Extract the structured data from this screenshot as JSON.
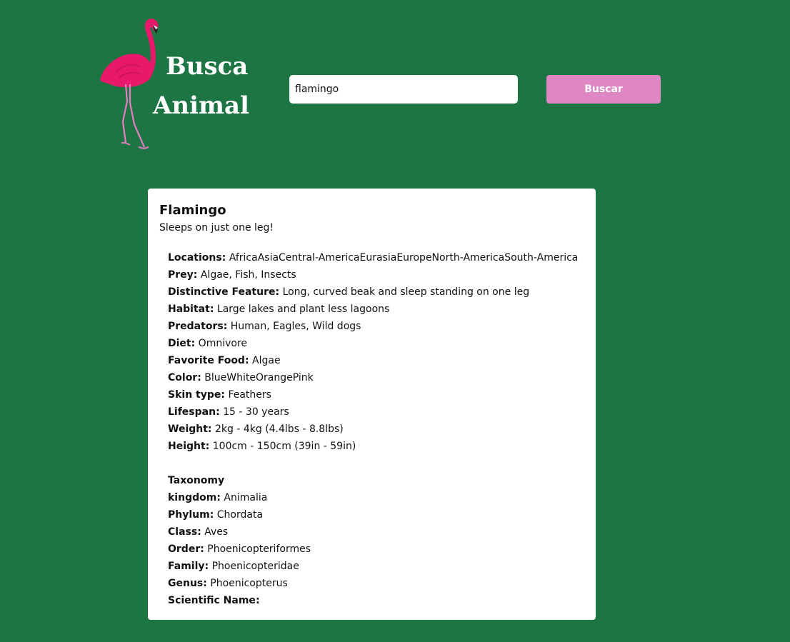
{
  "header": {
    "logo_line1": "Busca",
    "logo_line2": "Animal",
    "search_value": "flamingo",
    "search_button": "Buscar"
  },
  "colors": {
    "background": "#1c7543",
    "button": "#de87c3",
    "flamingo": "#e8196a"
  },
  "animal": {
    "name": "Flamingo",
    "slogan": "Sleeps on just one leg!",
    "characteristics": [
      {
        "label": "Locations",
        "value": "AfricaAsiaCentral-AmericaEurasiaEuropeNorth-AmericaSouth-America"
      },
      {
        "label": "Prey",
        "value": "Algae, Fish, Insects"
      },
      {
        "label": "Distinctive Feature",
        "value": "Long, curved beak and sleep standing on one leg"
      },
      {
        "label": "Habitat",
        "value": "Large lakes and plant less lagoons"
      },
      {
        "label": "Predators",
        "value": "Human, Eagles, Wild dogs"
      },
      {
        "label": "Diet",
        "value": "Omnivore"
      },
      {
        "label": "Favorite Food",
        "value": "Algae"
      },
      {
        "label": "Color",
        "value": "BlueWhiteOrangePink"
      },
      {
        "label": "Skin type",
        "value": "Feathers"
      },
      {
        "label": "Lifespan",
        "value": "15 - 30 years"
      },
      {
        "label": "Weight",
        "value": "2kg - 4kg (4.4lbs - 8.8lbs)"
      },
      {
        "label": "Height",
        "value": "100cm - 150cm (39in - 59in)"
      }
    ],
    "taxonomy_heading": "Taxonomy",
    "taxonomy": [
      {
        "label": "kingdom",
        "value": "Animalia"
      },
      {
        "label": "Phylum",
        "value": "Chordata"
      },
      {
        "label": "Class",
        "value": "Aves"
      },
      {
        "label": "Order",
        "value": "Phoenicopteriformes"
      },
      {
        "label": "Family",
        "value": "Phoenicopteridae"
      },
      {
        "label": "Genus",
        "value": "Phoenicopterus"
      },
      {
        "label": "Scientific Name",
        "value": ""
      }
    ]
  }
}
